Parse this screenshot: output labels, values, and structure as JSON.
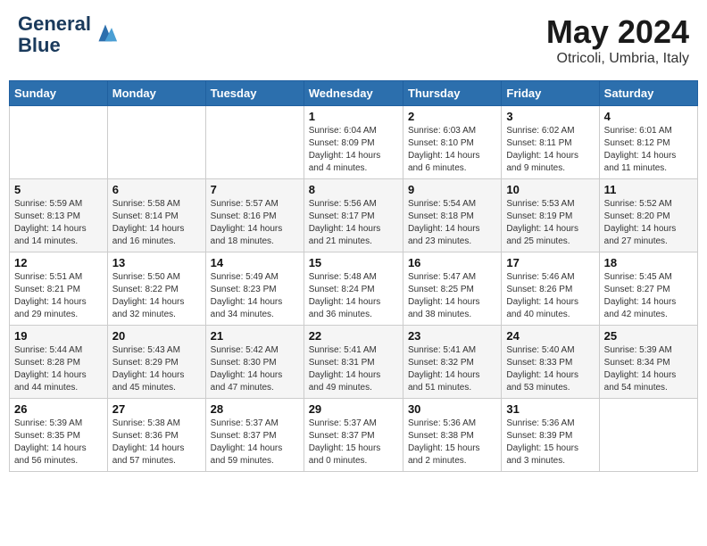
{
  "header": {
    "logo_line1": "General",
    "logo_line2": "Blue",
    "month": "May 2024",
    "location": "Otricoli, Umbria, Italy"
  },
  "columns": [
    "Sunday",
    "Monday",
    "Tuesday",
    "Wednesday",
    "Thursday",
    "Friday",
    "Saturday"
  ],
  "weeks": [
    {
      "days": [
        {
          "num": "",
          "info": ""
        },
        {
          "num": "",
          "info": ""
        },
        {
          "num": "",
          "info": ""
        },
        {
          "num": "1",
          "info": "Sunrise: 6:04 AM\nSunset: 8:09 PM\nDaylight: 14 hours\nand 4 minutes."
        },
        {
          "num": "2",
          "info": "Sunrise: 6:03 AM\nSunset: 8:10 PM\nDaylight: 14 hours\nand 6 minutes."
        },
        {
          "num": "3",
          "info": "Sunrise: 6:02 AM\nSunset: 8:11 PM\nDaylight: 14 hours\nand 9 minutes."
        },
        {
          "num": "4",
          "info": "Sunrise: 6:01 AM\nSunset: 8:12 PM\nDaylight: 14 hours\nand 11 minutes."
        }
      ]
    },
    {
      "days": [
        {
          "num": "5",
          "info": "Sunrise: 5:59 AM\nSunset: 8:13 PM\nDaylight: 14 hours\nand 14 minutes."
        },
        {
          "num": "6",
          "info": "Sunrise: 5:58 AM\nSunset: 8:14 PM\nDaylight: 14 hours\nand 16 minutes."
        },
        {
          "num": "7",
          "info": "Sunrise: 5:57 AM\nSunset: 8:16 PM\nDaylight: 14 hours\nand 18 minutes."
        },
        {
          "num": "8",
          "info": "Sunrise: 5:56 AM\nSunset: 8:17 PM\nDaylight: 14 hours\nand 21 minutes."
        },
        {
          "num": "9",
          "info": "Sunrise: 5:54 AM\nSunset: 8:18 PM\nDaylight: 14 hours\nand 23 minutes."
        },
        {
          "num": "10",
          "info": "Sunrise: 5:53 AM\nSunset: 8:19 PM\nDaylight: 14 hours\nand 25 minutes."
        },
        {
          "num": "11",
          "info": "Sunrise: 5:52 AM\nSunset: 8:20 PM\nDaylight: 14 hours\nand 27 minutes."
        }
      ]
    },
    {
      "days": [
        {
          "num": "12",
          "info": "Sunrise: 5:51 AM\nSunset: 8:21 PM\nDaylight: 14 hours\nand 29 minutes."
        },
        {
          "num": "13",
          "info": "Sunrise: 5:50 AM\nSunset: 8:22 PM\nDaylight: 14 hours\nand 32 minutes."
        },
        {
          "num": "14",
          "info": "Sunrise: 5:49 AM\nSunset: 8:23 PM\nDaylight: 14 hours\nand 34 minutes."
        },
        {
          "num": "15",
          "info": "Sunrise: 5:48 AM\nSunset: 8:24 PM\nDaylight: 14 hours\nand 36 minutes."
        },
        {
          "num": "16",
          "info": "Sunrise: 5:47 AM\nSunset: 8:25 PM\nDaylight: 14 hours\nand 38 minutes."
        },
        {
          "num": "17",
          "info": "Sunrise: 5:46 AM\nSunset: 8:26 PM\nDaylight: 14 hours\nand 40 minutes."
        },
        {
          "num": "18",
          "info": "Sunrise: 5:45 AM\nSunset: 8:27 PM\nDaylight: 14 hours\nand 42 minutes."
        }
      ]
    },
    {
      "days": [
        {
          "num": "19",
          "info": "Sunrise: 5:44 AM\nSunset: 8:28 PM\nDaylight: 14 hours\nand 44 minutes."
        },
        {
          "num": "20",
          "info": "Sunrise: 5:43 AM\nSunset: 8:29 PM\nDaylight: 14 hours\nand 45 minutes."
        },
        {
          "num": "21",
          "info": "Sunrise: 5:42 AM\nSunset: 8:30 PM\nDaylight: 14 hours\nand 47 minutes."
        },
        {
          "num": "22",
          "info": "Sunrise: 5:41 AM\nSunset: 8:31 PM\nDaylight: 14 hours\nand 49 minutes."
        },
        {
          "num": "23",
          "info": "Sunrise: 5:41 AM\nSunset: 8:32 PM\nDaylight: 14 hours\nand 51 minutes."
        },
        {
          "num": "24",
          "info": "Sunrise: 5:40 AM\nSunset: 8:33 PM\nDaylight: 14 hours\nand 53 minutes."
        },
        {
          "num": "25",
          "info": "Sunrise: 5:39 AM\nSunset: 8:34 PM\nDaylight: 14 hours\nand 54 minutes."
        }
      ]
    },
    {
      "days": [
        {
          "num": "26",
          "info": "Sunrise: 5:39 AM\nSunset: 8:35 PM\nDaylight: 14 hours\nand 56 minutes."
        },
        {
          "num": "27",
          "info": "Sunrise: 5:38 AM\nSunset: 8:36 PM\nDaylight: 14 hours\nand 57 minutes."
        },
        {
          "num": "28",
          "info": "Sunrise: 5:37 AM\nSunset: 8:37 PM\nDaylight: 14 hours\nand 59 minutes."
        },
        {
          "num": "29",
          "info": "Sunrise: 5:37 AM\nSunset: 8:37 PM\nDaylight: 15 hours\nand 0 minutes."
        },
        {
          "num": "30",
          "info": "Sunrise: 5:36 AM\nSunset: 8:38 PM\nDaylight: 15 hours\nand 2 minutes."
        },
        {
          "num": "31",
          "info": "Sunrise: 5:36 AM\nSunset: 8:39 PM\nDaylight: 15 hours\nand 3 minutes."
        },
        {
          "num": "",
          "info": ""
        }
      ]
    }
  ]
}
